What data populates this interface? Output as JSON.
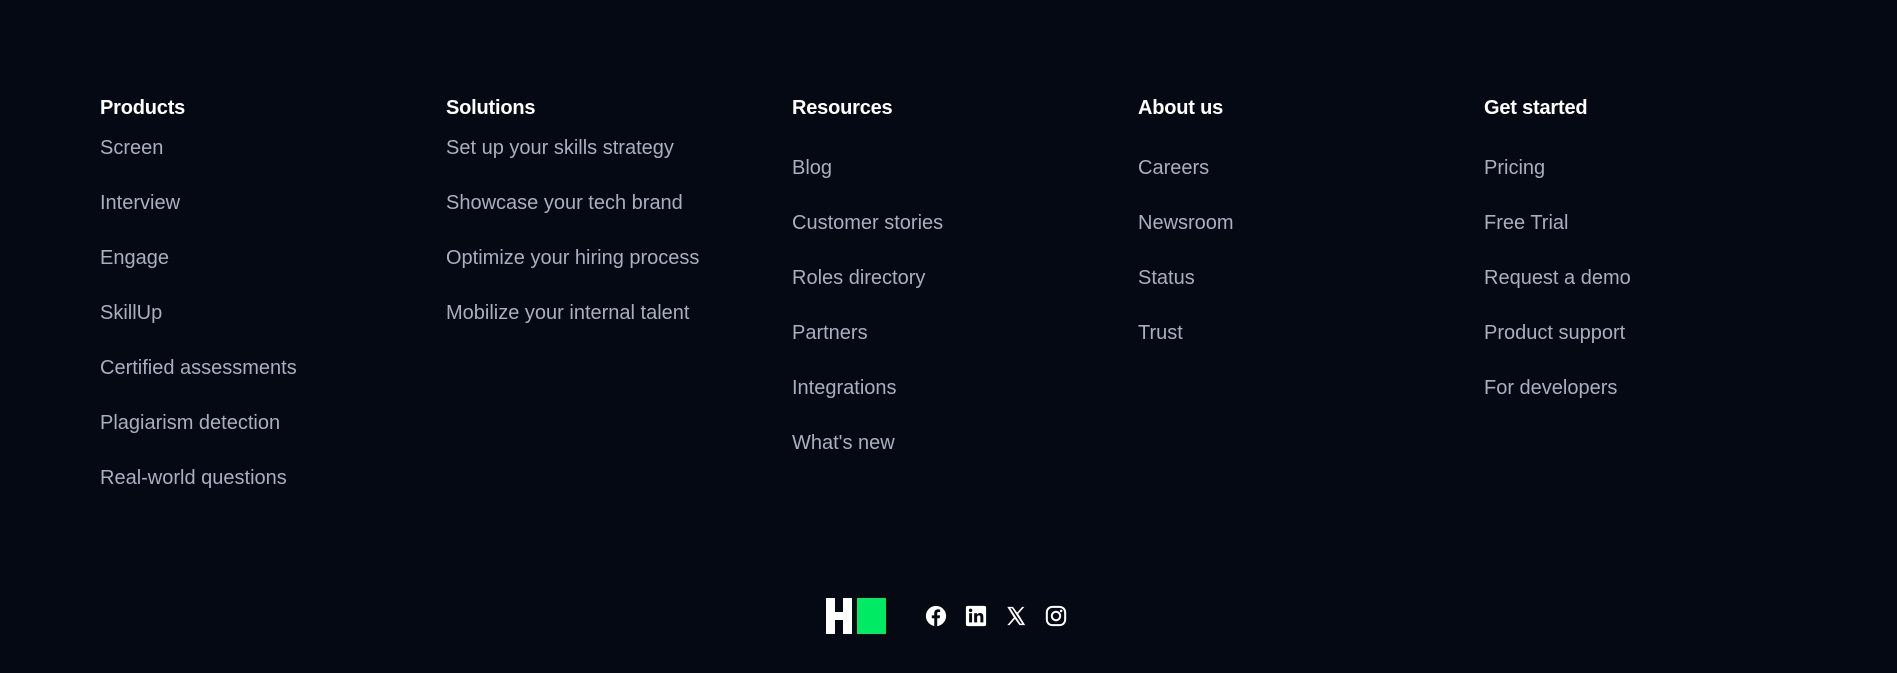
{
  "footer": {
    "columns": [
      {
        "heading": "Products",
        "links": [
          "Screen",
          "Interview",
          "Engage",
          "SkillUp",
          "Certified assessments",
          "Plagiarism detection",
          "Real-world questions"
        ]
      },
      {
        "heading": "Solutions",
        "links": [
          "Set up your skills strategy",
          "Showcase your tech brand",
          "Optimize your hiring process",
          "Mobilize your internal talent"
        ]
      },
      {
        "heading": "Resources",
        "links": [
          "Blog",
          "Customer stories",
          "Roles directory",
          "Partners",
          "Integrations",
          "What's new"
        ]
      },
      {
        "heading": "About us",
        "links": [
          "Careers",
          "Newsroom",
          "Status",
          "Trust"
        ]
      },
      {
        "heading": "Get started",
        "links": [
          "Pricing",
          "Free Trial",
          "Request a demo",
          "Product support",
          "For developers"
        ]
      }
    ],
    "brand": {
      "logo_icon": "hackerrank-logo",
      "accent_color": "#00EA64"
    },
    "social": [
      {
        "icon": "facebook-icon"
      },
      {
        "icon": "linkedin-icon"
      },
      {
        "icon": "x-icon"
      },
      {
        "icon": "instagram-icon"
      }
    ],
    "colors": {
      "background": "#050914",
      "heading": "#FFFFFF",
      "link": "#A9AFBE"
    }
  }
}
